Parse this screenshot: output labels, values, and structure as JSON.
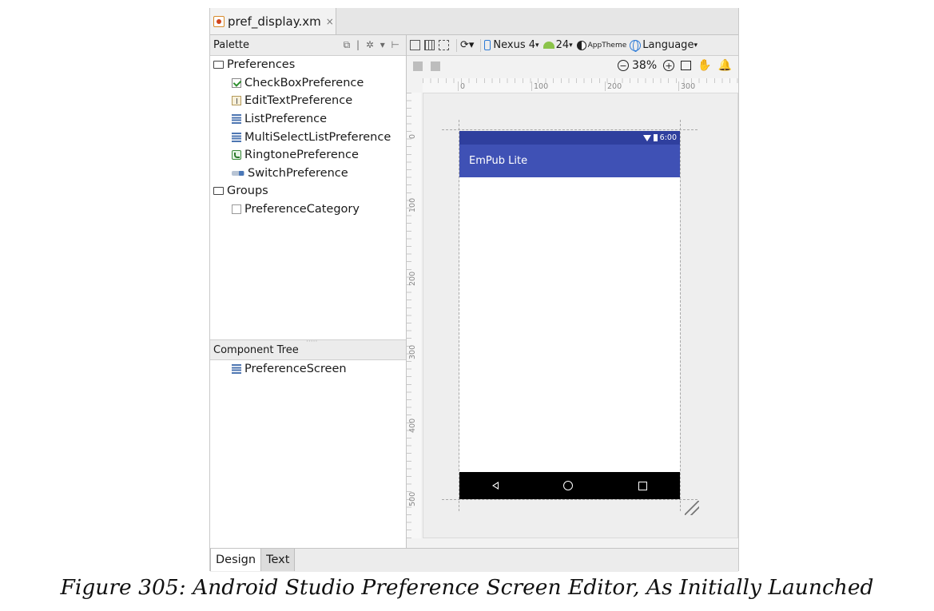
{
  "editor_tab": {
    "filename": "pref_display.xm",
    "close": "×"
  },
  "palette": {
    "title": "Palette",
    "tools": "⧉ | ✲ ▾ ⊢",
    "categories": [
      {
        "label": "Preferences",
        "items": [
          {
            "label": "CheckBoxPreference",
            "icon": "checkbox-icon"
          },
          {
            "label": "EditTextPreference",
            "icon": "text-field-icon"
          },
          {
            "label": "ListPreference",
            "icon": "list-icon"
          },
          {
            "label": "MultiSelectListPreference",
            "icon": "list-icon"
          },
          {
            "label": "RingtonePreference",
            "icon": "phone-icon"
          },
          {
            "label": "SwitchPreference",
            "icon": "switch-icon"
          }
        ]
      },
      {
        "label": "Groups",
        "items": [
          {
            "label": "PreferenceCategory",
            "icon": "category-icon"
          }
        ]
      }
    ]
  },
  "component_tree": {
    "title": "Component Tree",
    "items": [
      {
        "label": "PreferenceScreen",
        "icon": "list-icon"
      }
    ]
  },
  "toolbar": {
    "device": "Nexus 4",
    "api": "24",
    "theme": "AppTheme",
    "language": "Language"
  },
  "zoom": {
    "level": "38%"
  },
  "ruler": {
    "h": [
      "0",
      "100",
      "200",
      "300"
    ],
    "v": [
      "0",
      "100",
      "200",
      "300",
      "400",
      "500"
    ]
  },
  "device": {
    "status_time": "6:00",
    "app_title": "EmPub Lite",
    "status_bar_color": "#2f3f9e",
    "app_bar_color": "#3f51b5"
  },
  "bottom_tabs": [
    {
      "label": "Design",
      "active": true
    },
    {
      "label": "Text",
      "active": false
    }
  ],
  "caption": "Figure 305: Android Studio Preference Screen Editor, As Initially Launched"
}
